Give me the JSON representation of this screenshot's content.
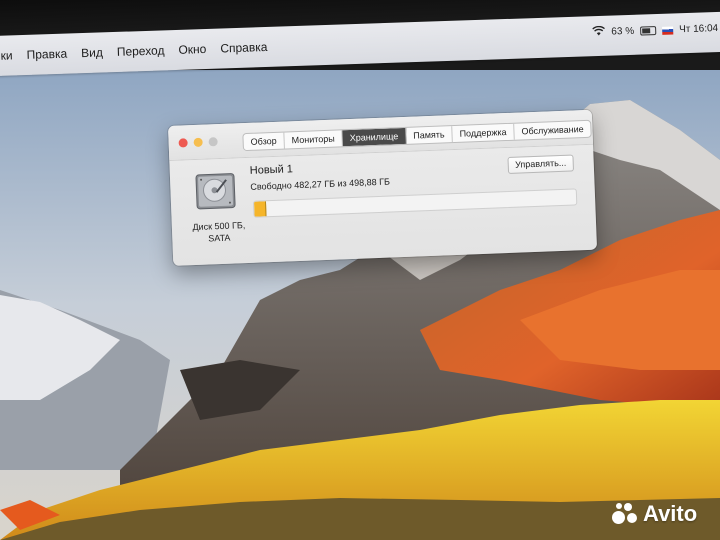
{
  "menubar": {
    "items": [
      "ки",
      "Правка",
      "Вид",
      "Переход",
      "Окно",
      "Справка"
    ],
    "battery": "63 %",
    "clock": "Чт 16:04"
  },
  "window": {
    "tabs": [
      {
        "label": "Обзор",
        "active": false
      },
      {
        "label": "Мониторы",
        "active": false
      },
      {
        "label": "Хранилище",
        "active": true
      },
      {
        "label": "Память",
        "active": false
      },
      {
        "label": "Поддержка",
        "active": false
      },
      {
        "label": "Обслуживание",
        "active": false
      }
    ],
    "disk": {
      "icon": "hard-drive-icon",
      "label_line1": "Диск 500 ГБ,",
      "label_line2": "SATA"
    },
    "volume": {
      "name": "Новый 1",
      "free_text": "Свободно 482,27 ГБ из 498,88 ГБ",
      "used_fraction": 0.033,
      "bar_color": "#f5b52a"
    },
    "manage_button": "Управлять..."
  },
  "watermark": {
    "text": "Avito"
  }
}
